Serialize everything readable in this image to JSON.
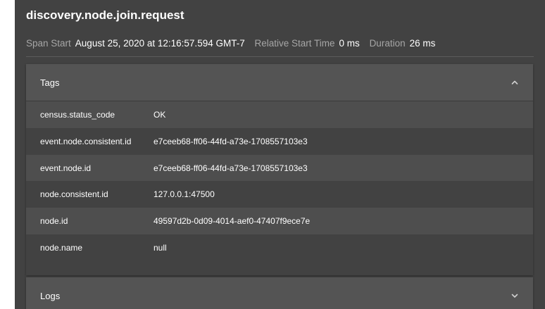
{
  "span": {
    "title": "discovery.node.join.request",
    "start_label": "Span Start",
    "start_value": "August 25, 2020 at 12:16:57.594 GMT-7",
    "relative_label": "Relative Start Time",
    "relative_value": "0 ms",
    "duration_label": "Duration",
    "duration_value": "26 ms"
  },
  "tags": {
    "title": "Tags",
    "expanded": true,
    "chevron_icon": "chevron-up-icon",
    "rows": [
      {
        "key": "census.status_code",
        "value": "OK"
      },
      {
        "key": "event.node.consistent.id",
        "value": "e7ceeb68-ff06-44fd-a73e-1708557103e3"
      },
      {
        "key": "event.node.id",
        "value": "e7ceeb68-ff06-44fd-a73e-1708557103e3"
      },
      {
        "key": "node.consistent.id",
        "value": "127.0.0.1:47500"
      },
      {
        "key": "node.id",
        "value": "49597d2b-0d09-4014-aef0-47407f9ece7e"
      },
      {
        "key": "node.name",
        "value": "null"
      }
    ]
  },
  "logs": {
    "title": "Logs",
    "expanded": false,
    "chevron_icon": "chevron-down-icon"
  },
  "colors": {
    "panel_bg": "#424242",
    "section_header_bg": "#545454",
    "row_alt_bg": "#4e4e4e",
    "label_text": "#a6a6a6",
    "value_text": "#ffffff"
  }
}
